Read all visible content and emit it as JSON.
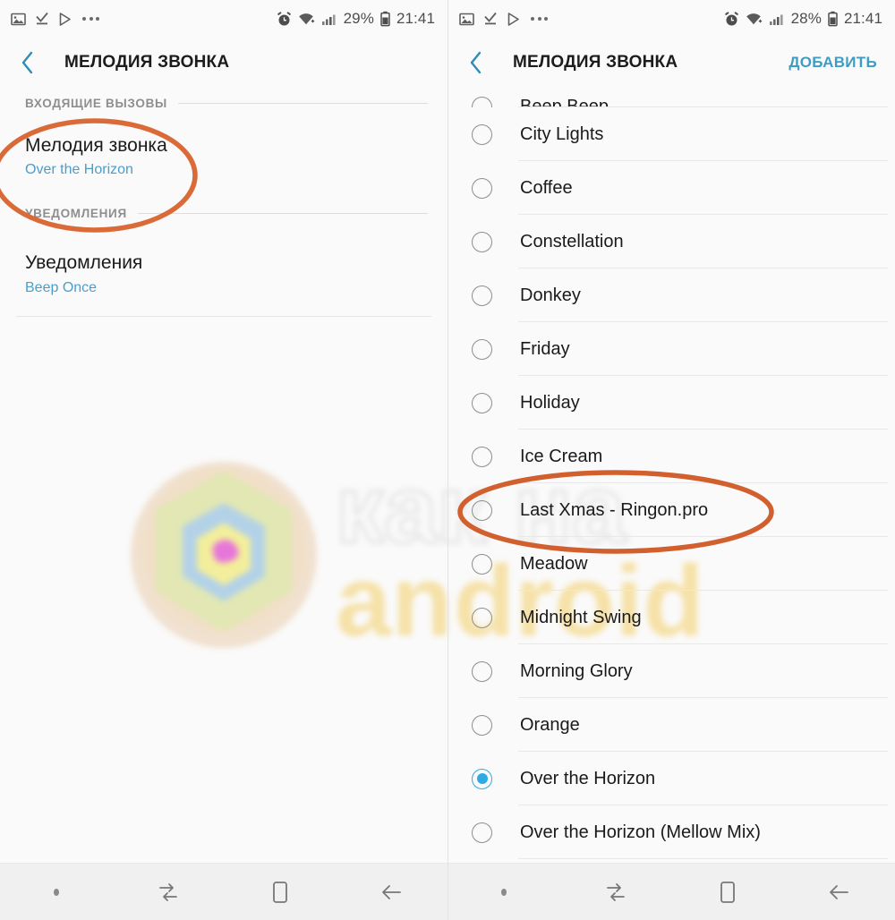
{
  "left_panel": {
    "status_bar": {
      "icons": [
        "image-icon",
        "download-done-icon",
        "play-store-icon",
        "more-dots-icon"
      ],
      "alarm_icon": "alarm-icon",
      "wifi_icon": "wifi-icon",
      "signal_icon": "signal-bars-icon",
      "battery_percent": "29%",
      "battery_icon": "battery-icon",
      "clock": "21:41"
    },
    "app_bar": {
      "back_icon": "chevron-left-icon",
      "title": "МЕЛОДИЯ ЗВОНКА"
    },
    "sections": [
      {
        "header": "ВХОДЯЩИЕ ВЫЗОВЫ",
        "item": {
          "title": "Мелодия звонка",
          "subtitle": "Over the Horizon",
          "highlighted": true
        }
      },
      {
        "header": "УВЕДОМЛЕНИЯ",
        "item": {
          "title": "Уведомления",
          "subtitle": "Beep Once",
          "highlighted": false
        }
      }
    ]
  },
  "right_panel": {
    "status_bar": {
      "icons": [
        "image-icon",
        "download-done-icon",
        "play-store-icon",
        "more-dots-icon"
      ],
      "alarm_icon": "alarm-icon",
      "wifi_icon": "wifi-icon",
      "signal_icon": "signal-bars-icon",
      "battery_percent": "28%",
      "battery_icon": "battery-icon",
      "clock": "21:41"
    },
    "app_bar": {
      "back_icon": "chevron-left-icon",
      "title": "МЕЛОДИЯ ЗВОНКА",
      "action": "ДОБАВИТЬ"
    },
    "ringtones": [
      {
        "label": "Beep Beep",
        "selected": false,
        "clipped": true
      },
      {
        "label": "City Lights",
        "selected": false
      },
      {
        "label": "Coffee",
        "selected": false
      },
      {
        "label": "Constellation",
        "selected": false
      },
      {
        "label": "Donkey",
        "selected": false
      },
      {
        "label": "Friday",
        "selected": false
      },
      {
        "label": "Holiday",
        "selected": false
      },
      {
        "label": "Ice Cream",
        "selected": false
      },
      {
        "label": "Last Xmas - Ringon.pro",
        "selected": false,
        "highlighted": true
      },
      {
        "label": "Meadow",
        "selected": false
      },
      {
        "label": "Midnight Swing",
        "selected": false
      },
      {
        "label": "Morning Glory",
        "selected": false
      },
      {
        "label": "Orange",
        "selected": false
      },
      {
        "label": "Over the Horizon",
        "selected": true
      },
      {
        "label": "Over the Horizon (Mellow Mix)",
        "selected": false
      }
    ]
  },
  "nav_bar": {
    "items": [
      "dot-icon",
      "swap-arrows-icon",
      "recents-icon",
      "back-arrow-icon"
    ]
  },
  "watermark": {
    "line1": "как на",
    "line2": "android"
  },
  "colors": {
    "accent_blue": "#3f9dc4",
    "radio_selected": "#2eabe2",
    "annotation_orange": "#da6b38",
    "subtitle_blue": "#4b9ec9",
    "background": "#fafafa",
    "nav_background": "#f0f0f0"
  }
}
